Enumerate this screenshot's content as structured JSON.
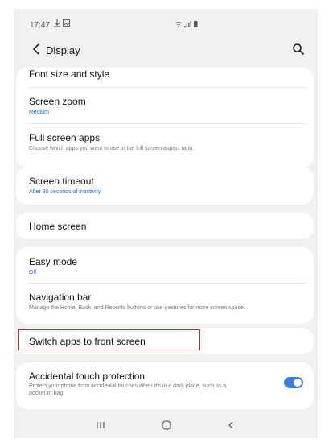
{
  "status_bar": {
    "time": "17:47",
    "notification_icons": [
      "download-icon",
      "gallery-icon"
    ],
    "system_icons": [
      "wifi-icon",
      "signal-icon",
      "battery-icon"
    ]
  },
  "app_bar": {
    "back_icon": "chevron-left-icon",
    "title": "Display",
    "search_icon": "search-icon"
  },
  "settings": {
    "font_size_style": {
      "title": "Font size and style"
    },
    "screen_zoom": {
      "title": "Screen zoom",
      "value": "Medium"
    },
    "full_screen_apps": {
      "title": "Full screen apps",
      "subtitle": "Choose which apps you want to use in the full screen aspect ratio."
    },
    "screen_timeout": {
      "title": "Screen timeout",
      "value": "After 30 seconds of inactivity."
    },
    "home_screen": {
      "title": "Home screen"
    },
    "easy_mode": {
      "title": "Easy mode",
      "value": "Off"
    },
    "navigation_bar": {
      "title": "Navigation bar",
      "subtitle": "Manage the Home, Back, and Recents buttons or use gestures for more screen space."
    },
    "switch_apps": {
      "title": "Switch apps to front screen"
    },
    "accidental_touch": {
      "title": "Accidental touch protection",
      "subtitle_line1": "Protect your phone from accidental touches when it's in a dark place, such as a",
      "subtitle_line2": "pocket or bag.",
      "enabled": true
    }
  },
  "colors": {
    "accent": "#3d7fe0",
    "link_blue": "#1a6fd0",
    "highlight": "#c52a2a",
    "background": "#f1f1f1"
  },
  "nav_bar": [
    "recents-icon",
    "home-icon",
    "back-icon"
  ]
}
